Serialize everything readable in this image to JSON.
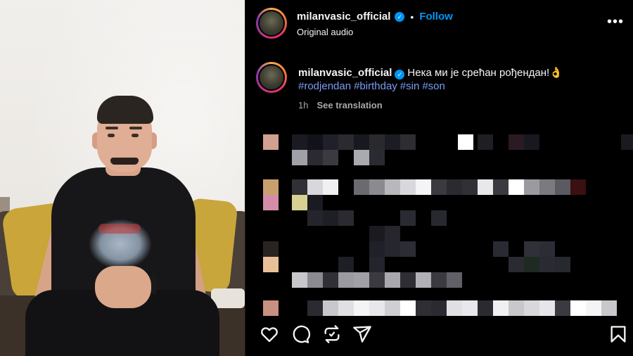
{
  "header": {
    "username": "milanvasic_official",
    "separator": "•",
    "follow_label": "Follow",
    "audio_label": "Original audio",
    "more_label": "•••"
  },
  "caption": {
    "username": "milanvasic_official",
    "text": "Нека ми је срећан рођендан!👌",
    "hashtags": [
      "#rodjendan",
      "#birthday",
      "#sin",
      "#son"
    ],
    "time": "1h",
    "see_translation": "See translation"
  },
  "actions": {
    "icons": [
      "heart-icon",
      "comment-icon",
      "repost-icon",
      "share-icon",
      "bookmark-icon"
    ]
  },
  "colors": {
    "background": "#000000",
    "link_blue": "#0095f6",
    "hashtag": "#7c9cf5",
    "muted": "#a8a8a8"
  }
}
